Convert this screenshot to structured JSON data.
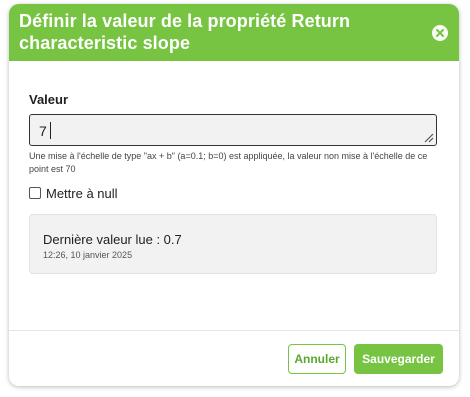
{
  "dialog": {
    "title": "Définir la valeur de la propriété Return characteristic slope",
    "close_icon": "close-icon"
  },
  "form": {
    "value_label": "Valeur",
    "value_input": "7",
    "help_text": "Une mise à l'échelle de type \"ax + b\" (a=0.1; b=0) est appliquée, la valeur non mise à l'échelle de ce point est 70",
    "null_checkbox_label": "Mettre à null",
    "null_checkbox_checked": false
  },
  "last_read": {
    "title": "Dernière valeur lue : 0.7",
    "timestamp": "12:26, 10 janvier 2025"
  },
  "footer": {
    "cancel_label": "Annuler",
    "save_label": "Sauvegarder"
  },
  "colors": {
    "accent": "#76c442",
    "header_text": "#ffffff"
  }
}
